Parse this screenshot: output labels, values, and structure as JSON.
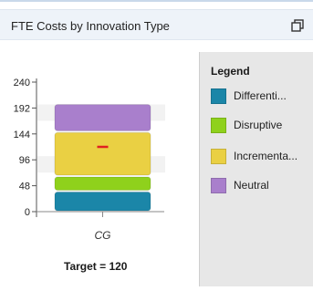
{
  "header": {
    "title": "FTE Costs by Innovation Type",
    "popout_icon": "popout-icon"
  },
  "legend": {
    "title": "Legend",
    "items": [
      {
        "label": "Differenti...",
        "color": "#1b86a8"
      },
      {
        "label": "Disruptive",
        "color": "#8fd11c"
      },
      {
        "label": "Incrementa...",
        "color": "#ead043"
      },
      {
        "label": "Neutral",
        "color": "#a97fcc"
      }
    ]
  },
  "chart_data": {
    "type": "bar",
    "stacked": true,
    "categories": [
      "CG"
    ],
    "series": [
      {
        "name": "Differenti...",
        "values": [
          38
        ],
        "color": "#1b86a8"
      },
      {
        "name": "Disruptive",
        "values": [
          28
        ],
        "color": "#8fd11c"
      },
      {
        "name": "Incrementa...",
        "values": [
          82
        ],
        "color": "#ead043"
      },
      {
        "name": "Neutral",
        "values": [
          52
        ],
        "color": "#a97fcc"
      }
    ],
    "y_ticks": [
      0,
      48,
      96,
      144,
      192,
      240
    ],
    "ylim": [
      0,
      240
    ],
    "target": {
      "label": "Target = 120",
      "value": 120,
      "marker_color": "#e02020"
    },
    "grid": false,
    "legend_position": "right"
  }
}
